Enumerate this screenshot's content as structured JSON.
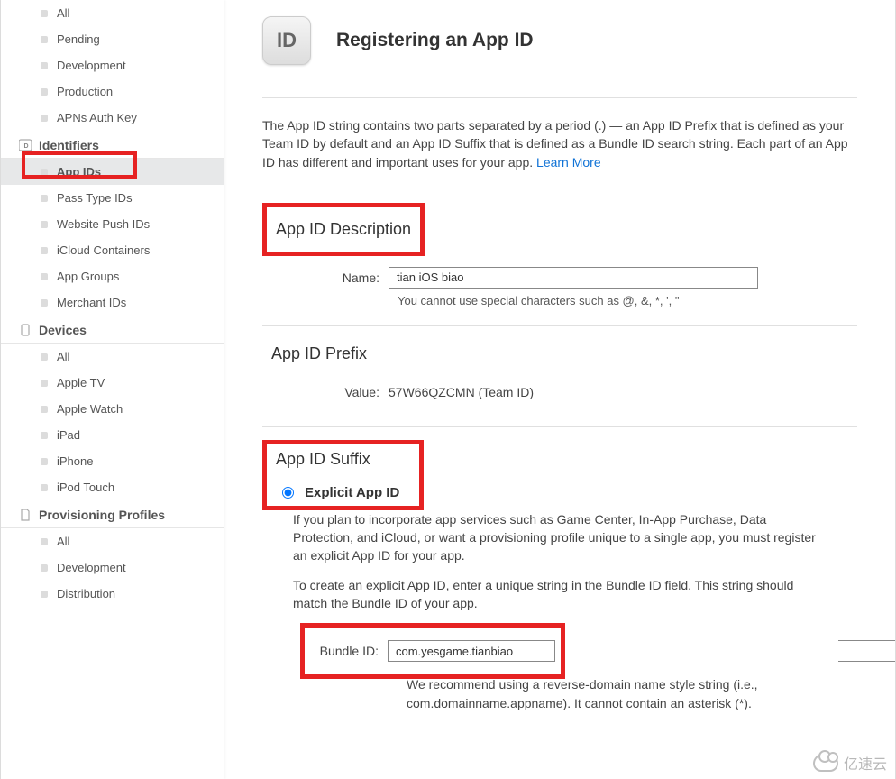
{
  "sidebar": {
    "group0": {
      "items": [
        {
          "label": "All"
        },
        {
          "label": "Pending"
        },
        {
          "label": "Development"
        },
        {
          "label": "Production"
        },
        {
          "label": "APNs Auth Key"
        }
      ]
    },
    "identifiers": {
      "heading": "Identifiers",
      "items": [
        {
          "label": "App IDs"
        },
        {
          "label": "Pass Type IDs"
        },
        {
          "label": "Website Push IDs"
        },
        {
          "label": "iCloud Containers"
        },
        {
          "label": "App Groups"
        },
        {
          "label": "Merchant IDs"
        }
      ]
    },
    "devices": {
      "heading": "Devices",
      "items": [
        {
          "label": "All"
        },
        {
          "label": "Apple TV"
        },
        {
          "label": "Apple Watch"
        },
        {
          "label": "iPad"
        },
        {
          "label": "iPhone"
        },
        {
          "label": "iPod Touch"
        }
      ]
    },
    "profiles": {
      "heading": "Provisioning Profiles",
      "items": [
        {
          "label": "All"
        },
        {
          "label": "Development"
        },
        {
          "label": "Distribution"
        }
      ]
    }
  },
  "header": {
    "badge": "ID",
    "title": "Registering an App ID"
  },
  "intro": {
    "text": "The App ID string contains two parts separated by a period (.) — an App ID Prefix that is defined as your Team ID by default and an App ID Suffix that is defined as a Bundle ID search string. Each part of an App ID has different and important uses for your app. ",
    "link": "Learn More"
  },
  "description": {
    "section_title": "App ID Description",
    "name_label": "Name:",
    "name_value": "tian iOS biao",
    "hint": "You cannot use special characters such as @, &, *, ', \""
  },
  "prefix": {
    "section_title": "App ID Prefix",
    "value_label": "Value:",
    "value_text": "57W66QZCMN (Team ID)"
  },
  "suffix": {
    "section_title": "App ID Suffix",
    "explicit_label": "Explicit App ID",
    "p1": "If you plan to incorporate app services such as Game Center, In-App Purchase, Data Protection, and iCloud, or want a provisioning profile unique to a single app, you must register an explicit App ID for your app.",
    "p2": "To create an explicit App ID, enter a unique string in the Bundle ID field. This string should match the Bundle ID of your app.",
    "bundle_label": "Bundle ID:",
    "bundle_value": "com.yesgame.tianbiao",
    "bundle_hint": "We recommend using a reverse-domain name style string (i.e., com.domainname.appname). It cannot contain an asterisk (*)."
  },
  "watermark": "亿速云"
}
